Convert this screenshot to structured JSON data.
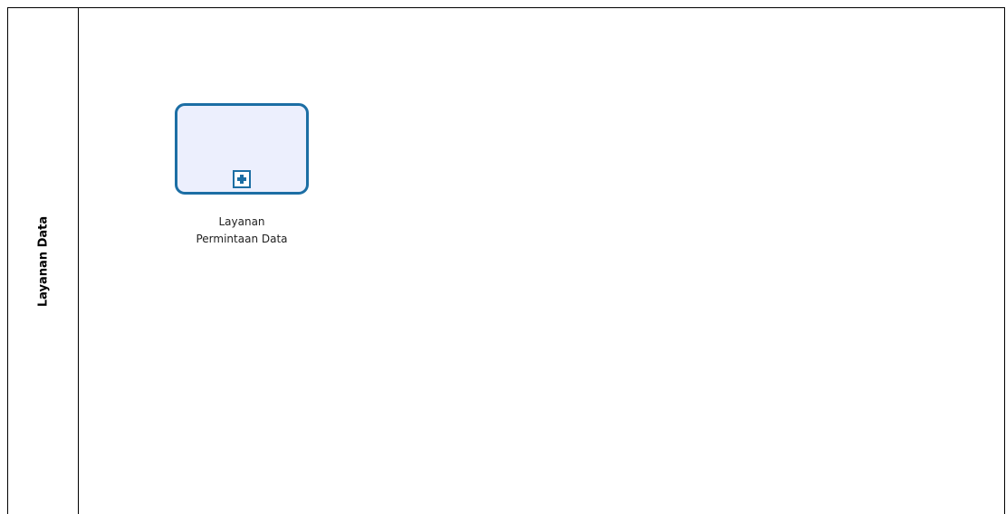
{
  "pool": {
    "label": "Layanan Data"
  },
  "subprocess": {
    "label_line1": "Layanan",
    "label_line2": "Permintaan Data",
    "marker_icon": "collapsed-subprocess-plus-icon"
  },
  "colors": {
    "task_border": "#1c6ea4",
    "task_fill": "#eceffd",
    "pool_border": "#000000"
  }
}
